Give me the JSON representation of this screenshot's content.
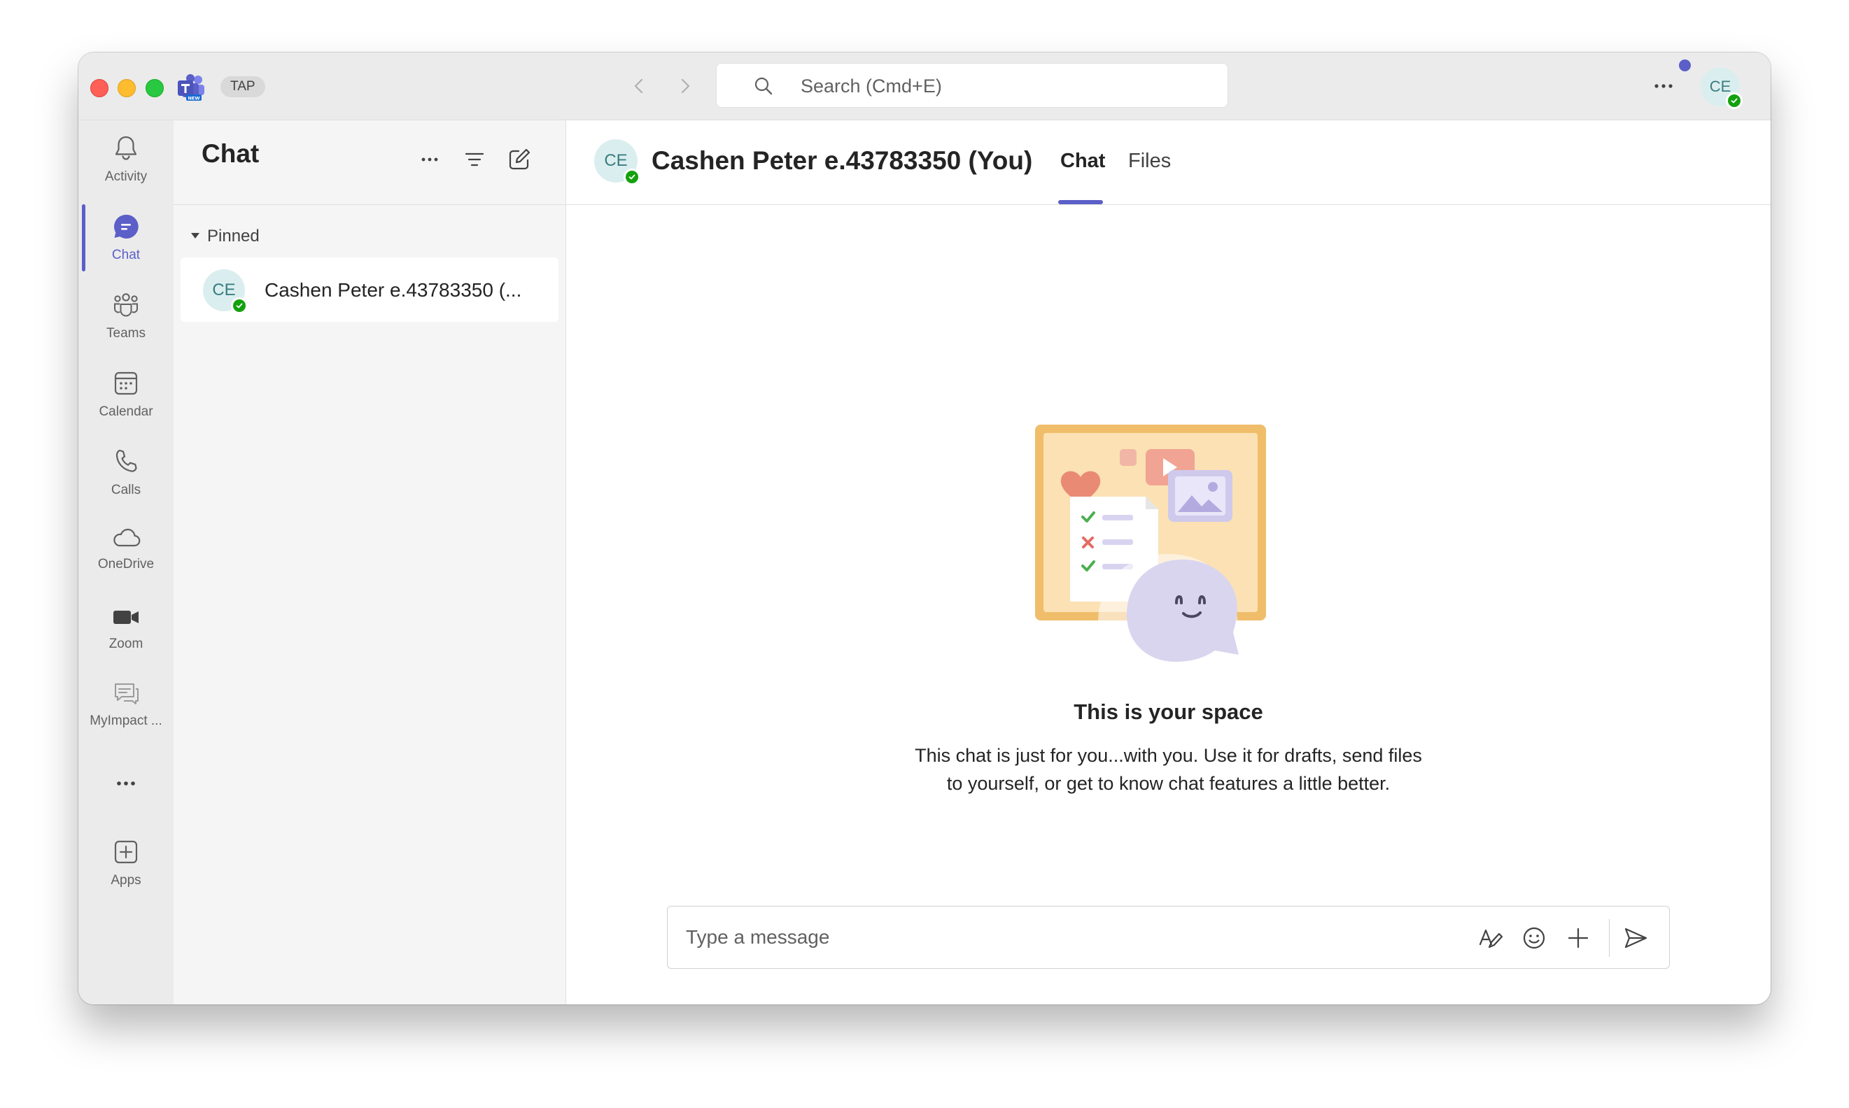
{
  "titlebar": {
    "org_badge": "TAP",
    "search_placeholder": "Search (Cmd+E)",
    "user_initials": "CE"
  },
  "rail": {
    "items": [
      {
        "label": "Activity",
        "icon": "bell-icon"
      },
      {
        "label": "Chat",
        "icon": "chat-icon",
        "active": true
      },
      {
        "label": "Teams",
        "icon": "teams-icon"
      },
      {
        "label": "Calendar",
        "icon": "calendar-icon"
      },
      {
        "label": "Calls",
        "icon": "phone-icon"
      },
      {
        "label": "OneDrive",
        "icon": "cloud-icon"
      },
      {
        "label": "Zoom",
        "icon": "video-camera-icon"
      },
      {
        "label": "MyImpact ...",
        "icon": "feedback-icon"
      },
      {
        "label": "Apps",
        "icon": "add-app-icon"
      }
    ]
  },
  "chat_list": {
    "title": "Chat",
    "section_label": "Pinned",
    "items": [
      {
        "initials": "CE",
        "name": "Cashen Peter e.43783350 (...",
        "status": "available"
      }
    ]
  },
  "conversation": {
    "initials": "CE",
    "name": "Cashen Peter e.43783350 (You)",
    "tabs": [
      {
        "label": "Chat",
        "active": true
      },
      {
        "label": "Files",
        "active": false
      }
    ],
    "empty_title": "This is your space",
    "empty_desc_line1": "This chat is just for you...with you. Use it for drafts, send files",
    "empty_desc_line2": "to yourself, or get to know chat features a little better.",
    "composer_placeholder": "Type a message"
  },
  "colors": {
    "accent": "#5b5fc7",
    "presence_available": "#13a10e",
    "avatar_bg": "#dbeeef"
  }
}
